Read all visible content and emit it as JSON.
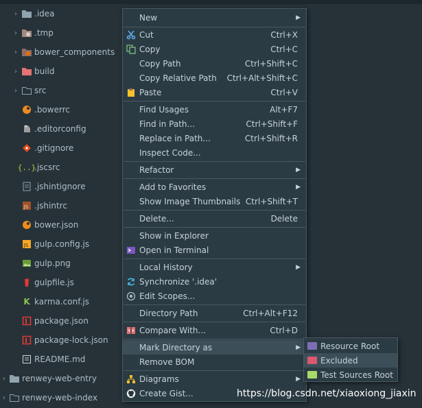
{
  "project_tree": {
    "items": [
      {
        "label": ".idea",
        "icon": "folder-icon",
        "arrow": "›"
      },
      {
        "label": ".tmp",
        "icon": "temp-folder-icon",
        "arrow": "›"
      },
      {
        "label": "bower_components",
        "icon": "bower-folder-icon",
        "arrow": "›"
      },
      {
        "label": "build",
        "icon": "build-folder-icon",
        "arrow": "›"
      },
      {
        "label": "src",
        "icon": "folder-icon",
        "arrow": "›"
      },
      {
        "label": ".bowerrc",
        "icon": "bower-icon"
      },
      {
        "label": ".editorconfig",
        "icon": "editorconfig-icon"
      },
      {
        "label": ".gitignore",
        "icon": "git-icon"
      },
      {
        "label": ".jscsrc",
        "icon": "json-braces-icon"
      },
      {
        "label": ".jshintignore",
        "icon": "text-file-icon"
      },
      {
        "label": ".jshintrc",
        "icon": "js-file-icon"
      },
      {
        "label": "bower.json",
        "icon": "bower-icon"
      },
      {
        "label": "gulp.config.js",
        "icon": "js-file-icon"
      },
      {
        "label": "gulp.png",
        "icon": "image-icon"
      },
      {
        "label": "gulpfile.js",
        "icon": "gulp-icon"
      },
      {
        "label": "karma.conf.js",
        "icon": "karma-icon"
      },
      {
        "label": "package.json",
        "icon": "npm-icon"
      },
      {
        "label": "package-lock.json",
        "icon": "npm-icon"
      },
      {
        "label": "README.md",
        "icon": "markdown-icon"
      },
      {
        "label": "renwey-web-entry",
        "icon": "folder-icon",
        "arrow": "›"
      },
      {
        "label": "renwey-web-index",
        "icon": "folder-icon",
        "arrow": "›"
      }
    ]
  },
  "context_menu": {
    "new": {
      "label": "New",
      "submenu_arrow": "▶"
    },
    "cut": {
      "label": "Cut",
      "shortcut": "Ctrl+X",
      "icon": "scissors-icon"
    },
    "copy": {
      "label": "Copy",
      "shortcut": "Ctrl+C",
      "icon": "copy-icon"
    },
    "copy_path": {
      "label": "Copy Path",
      "shortcut": "Ctrl+Shift+C"
    },
    "copy_relative_path": {
      "label": "Copy Relative Path",
      "shortcut": "Ctrl+Alt+Shift+C"
    },
    "paste": {
      "label": "Paste",
      "shortcut": "Ctrl+V",
      "icon": "clipboard-icon"
    },
    "find_usages": {
      "label": "Find Usages",
      "shortcut": "Alt+F7"
    },
    "find_in_path": {
      "label": "Find in Path...",
      "shortcut": "Ctrl+Shift+F"
    },
    "replace_in_path": {
      "label": "Replace in Path...",
      "shortcut": "Ctrl+Shift+R"
    },
    "inspect_code": {
      "label": "Inspect Code..."
    },
    "refactor": {
      "label": "Refactor",
      "submenu_arrow": "▶"
    },
    "add_to_favorites": {
      "label": "Add to Favorites",
      "submenu_arrow": "▶"
    },
    "show_image_thumbnails": {
      "label": "Show Image Thumbnails",
      "shortcut": "Ctrl+Shift+T"
    },
    "delete": {
      "label": "Delete...",
      "shortcut": "Delete"
    },
    "show_in_explorer": {
      "label": "Show in Explorer"
    },
    "open_in_terminal": {
      "label": "Open in Terminal",
      "icon": "terminal-icon"
    },
    "local_history": {
      "label": "Local History",
      "submenu_arrow": "▶"
    },
    "synchronize": {
      "label": "Synchronize '.idea'",
      "icon": "sync-icon"
    },
    "edit_scopes": {
      "label": "Edit Scopes...",
      "icon": "scope-icon"
    },
    "directory_path": {
      "label": "Directory Path",
      "shortcut": "Ctrl+Alt+F12"
    },
    "compare_with": {
      "label": "Compare With...",
      "shortcut": "Ctrl+D",
      "icon": "compare-icon"
    },
    "mark_directory_as": {
      "label": "Mark Directory as",
      "submenu_arrow": "▶"
    },
    "remove_bom": {
      "label": "Remove BOM"
    },
    "diagrams": {
      "label": "Diagrams",
      "submenu_arrow": "▶",
      "icon": "diagram-icon"
    },
    "create_gist": {
      "label": "Create Gist...",
      "icon": "github-icon"
    }
  },
  "mark_directory_submenu": {
    "resource_root": {
      "label": "Resource Root",
      "color": "#7e6fb5"
    },
    "excluded": {
      "label": "Excluded",
      "color": "#d9596e"
    },
    "test_sources_root": {
      "label": "Test Sources Root",
      "color": "#a6d86a"
    }
  },
  "watermark": "https://blog.csdn.net/xiaoxiong_jiaxin",
  "colors": {
    "background": "#263238",
    "menu_background": "#2b3b43",
    "highlight": "#3c4f59",
    "separator": "#4a5a62"
  }
}
